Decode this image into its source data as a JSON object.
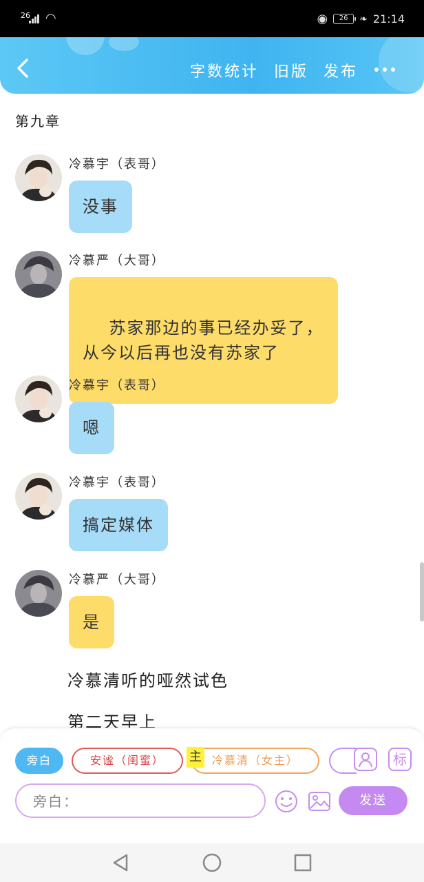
{
  "status_bar": {
    "network": "26",
    "battery": "26",
    "time": "21:14"
  },
  "header": {
    "actions": [
      "字数统计",
      "旧版",
      "发布"
    ],
    "accent_color": "#3fb4f0"
  },
  "chapter_title": "第九章",
  "messages": [
    {
      "speaker": "冷慕宇（表哥）",
      "text": "没事",
      "bubble_color": "#a6dcf8",
      "avatar": "man-with-cat-avatar"
    },
    {
      "speaker": "冷慕严（大哥）",
      "text": "苏家那边的事已经办妥了，\n从今以后再也没有苏家了",
      "bubble_color": "#fedc6a",
      "avatar": "man-in-shadow-avatar"
    },
    {
      "speaker": "冷慕宇（表哥）",
      "text": "嗯",
      "bubble_color": "#a6dcf8",
      "avatar": "man-with-cat-avatar"
    },
    {
      "speaker": "冷慕宇（表哥）",
      "text": "搞定媒体",
      "bubble_color": "#a6dcf8",
      "avatar": "man-with-cat-avatar"
    },
    {
      "speaker": "冷慕严（大哥）",
      "text": "是",
      "bubble_color": "#fedc6a",
      "avatar": "man-in-shadow-avatar"
    }
  ],
  "narration": [
    "冷慕清听的哑然试色",
    "第二天早上"
  ],
  "editor": {
    "roles": [
      {
        "label": "旁白",
        "color": "#4fb8f2"
      },
      {
        "label": "安谧（闺蜜）",
        "color": "#d64545"
      },
      {
        "label": "冷慕清（女主）",
        "color": "#ee9a4f"
      }
    ],
    "lead_tag": "主",
    "input_placeholder": "旁白：",
    "send_label": "发送",
    "tag_icon_label": "标"
  }
}
